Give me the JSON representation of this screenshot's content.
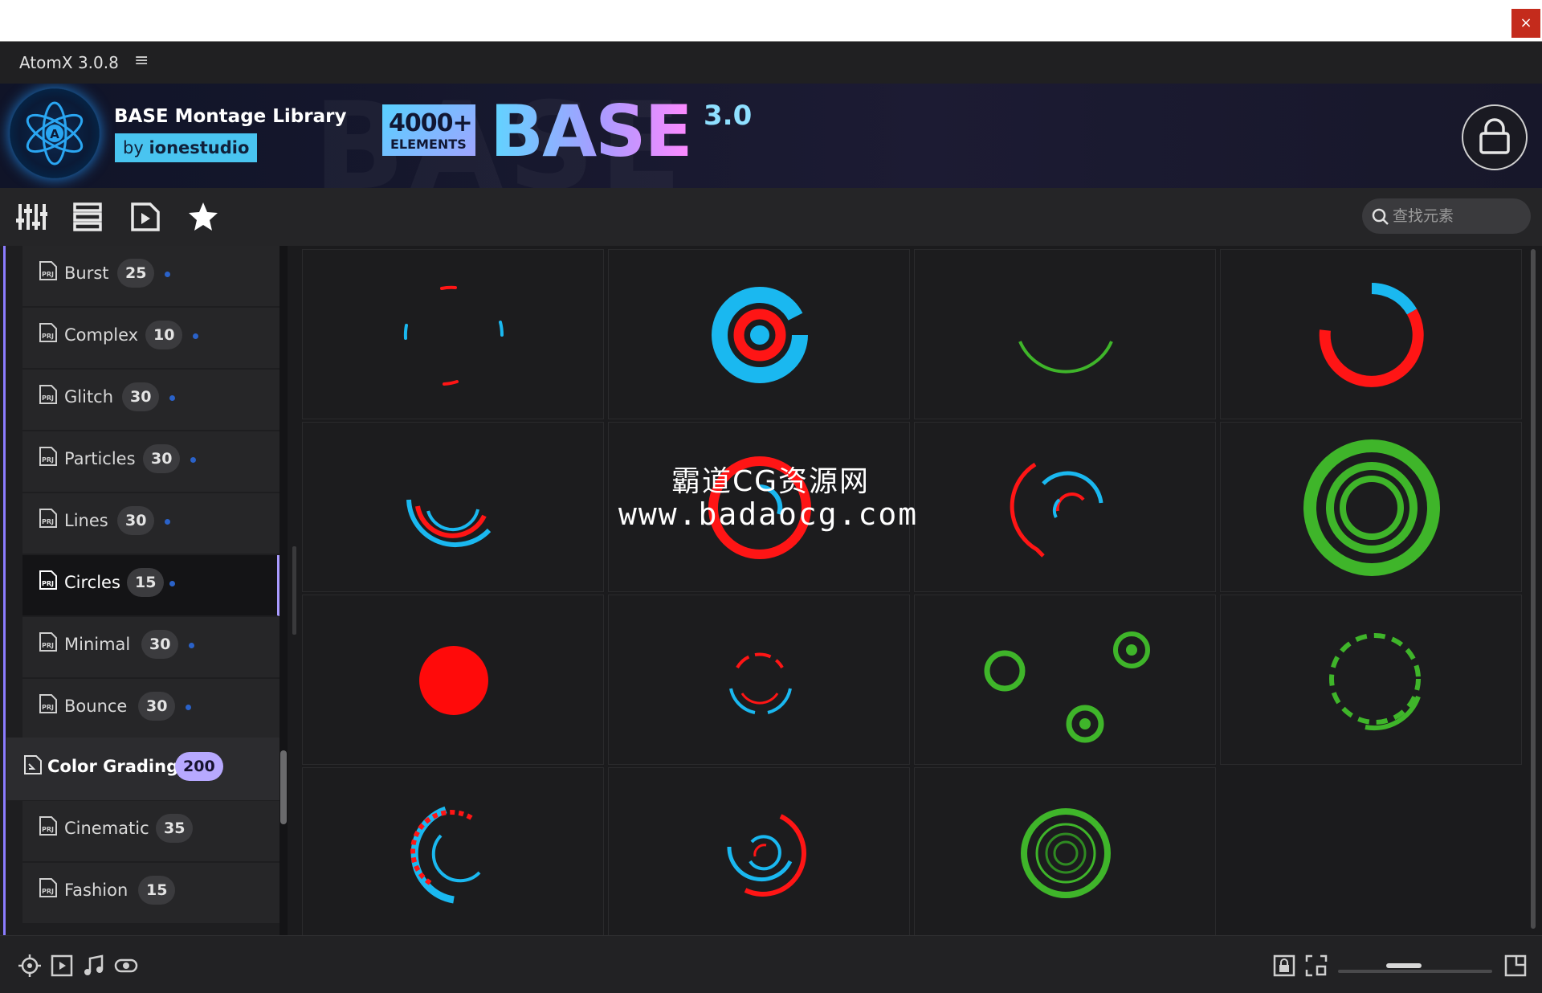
{
  "app": {
    "title": "AtomX 3.0.8",
    "menu_glyph": "≡",
    "close_glyph": "×"
  },
  "banner": {
    "library_name": "BASE Montage Library",
    "by_prefix": "by ",
    "author": "ionestudio",
    "badge_count": "4000+",
    "badge_unit": "ELEMENTS",
    "product": "BASE",
    "version": "3.0",
    "ghost_text": "BASE"
  },
  "toolbar": {
    "search_placeholder": "查找元素",
    "icons": [
      "sliders-icon",
      "list-icon",
      "play-file-icon",
      "star-icon"
    ]
  },
  "sidebar": {
    "items": [
      {
        "label": "Burst",
        "count": "25"
      },
      {
        "label": "Complex",
        "count": "10"
      },
      {
        "label": "Glitch",
        "count": "30"
      },
      {
        "label": "Particles",
        "count": "30"
      },
      {
        "label": "Lines",
        "count": "30"
      },
      {
        "label": "Circles",
        "count": "15",
        "active": true
      },
      {
        "label": "Minimal",
        "count": "30"
      },
      {
        "label": "Bounce",
        "count": "30"
      }
    ],
    "group": {
      "label": "Color Grading",
      "count": "200"
    },
    "sub_items": [
      {
        "label": "Cinematic",
        "count": "35"
      },
      {
        "label": "Fashion",
        "count": "15"
      }
    ]
  },
  "colors": {
    "red": "#ff1010",
    "blue": "#1ab8f0",
    "green": "#3fb52a",
    "accent": "#a99bff"
  },
  "watermark": {
    "line1": "霸道CG资源网",
    "line2": "www.badaocg.com"
  }
}
